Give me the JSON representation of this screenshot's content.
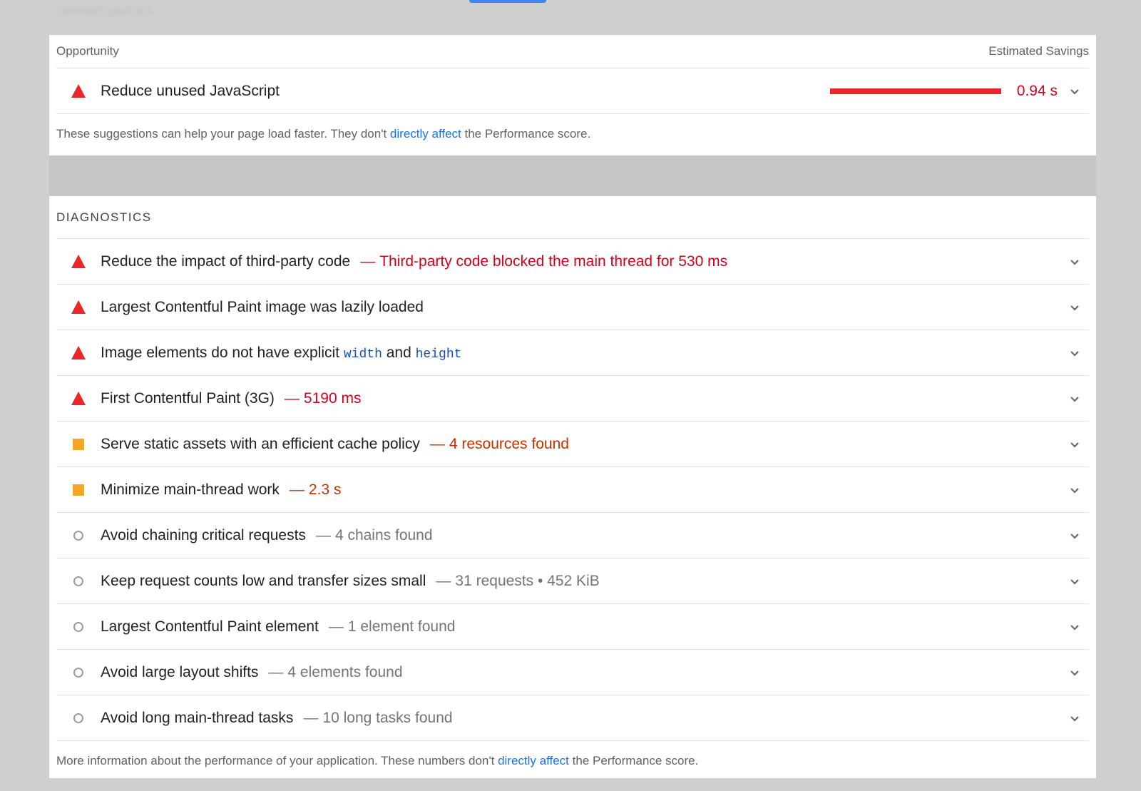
{
  "opportunities": {
    "faded_title": "OPPORTUNITIES",
    "column_left": "Opportunity",
    "column_right": "Estimated Savings",
    "items": [
      {
        "title": "Reduce unused JavaScript",
        "savings": "0.94 s",
        "bar_fraction": 1.0,
        "status": "fail"
      }
    ],
    "note_pre": "These suggestions can help your page load faster. They don't ",
    "note_link": "directly affect",
    "note_post": " the Performance score."
  },
  "diagnostics": {
    "title": "DIAGNOSTICS",
    "items": [
      {
        "status": "fail",
        "title": "Reduce the impact of third-party code",
        "separator": "—",
        "display": "Third-party code blocked the main thread for 530 ms"
      },
      {
        "status": "fail",
        "title": "Largest Contentful Paint image was lazily loaded",
        "separator": "",
        "display": ""
      },
      {
        "status": "fail",
        "title_pre": "Image elements do not have explicit ",
        "code1": "width",
        "title_mid": " and ",
        "code2": "height",
        "separator": "",
        "display": ""
      },
      {
        "status": "fail",
        "title": "First Contentful Paint (3G)",
        "separator": "—",
        "display": "5190 ms"
      },
      {
        "status": "average",
        "title": "Serve static assets with an efficient cache policy",
        "separator": "—",
        "display": "4 resources found"
      },
      {
        "status": "average",
        "title": "Minimize main-thread work",
        "separator": "—",
        "display": "2.3 s"
      },
      {
        "status": "info",
        "title": "Avoid chaining critical requests",
        "separator": "—",
        "display": "4 chains found"
      },
      {
        "status": "info",
        "title": "Keep request counts low and transfer sizes small",
        "separator": "—",
        "display": "31 requests • 452 KiB"
      },
      {
        "status": "info",
        "title": "Largest Contentful Paint element",
        "separator": "—",
        "display": "1 element found"
      },
      {
        "status": "info",
        "title": "Avoid large layout shifts",
        "separator": "—",
        "display": "4 elements found"
      },
      {
        "status": "info",
        "title": "Avoid long main-thread tasks",
        "separator": "—",
        "display": "10 long tasks found"
      }
    ],
    "note_pre": "More information about the performance of your application. These numbers don't ",
    "note_link": "directly affect",
    "note_post": " the Performance score."
  },
  "colors": {
    "fail": "#e8262b",
    "average": "#f5a623",
    "info": "#9e9e9e",
    "link": "#1a73e8"
  },
  "icons": {
    "fail": "triangle-icon",
    "average": "square-icon",
    "info": "circle-icon",
    "expand": "chevron-down-icon"
  }
}
